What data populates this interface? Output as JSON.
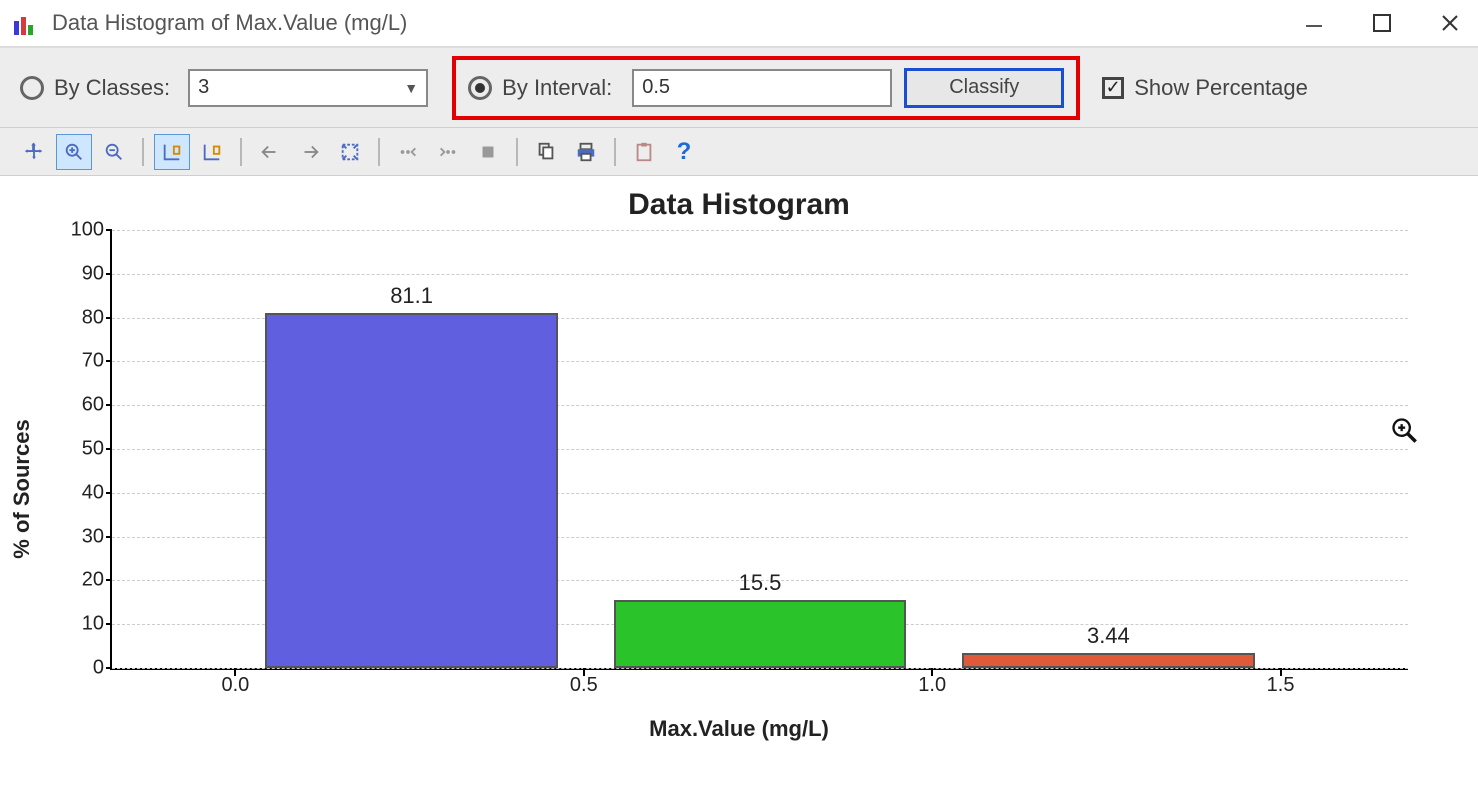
{
  "window": {
    "title": "Data Histogram of Max.Value (mg/L)"
  },
  "controls": {
    "by_classes_label": "By Classes:",
    "classes_value": "3",
    "by_interval_label": "By Interval:",
    "interval_value": "0.5",
    "classify_label": "Classify",
    "show_percentage_label": "Show Percentage",
    "classes_checked": false,
    "interval_checked": true,
    "show_percentage_checked": true
  },
  "toolbar": {
    "icons": [
      "pan",
      "zoom-in",
      "zoom-out",
      "axis-lock-x",
      "axis-lock-y",
      "undo-axis",
      "redo-axis",
      "fit",
      "step-left",
      "step-right",
      "stop",
      "copy",
      "print",
      "paste",
      "help"
    ]
  },
  "chart_data": {
    "type": "bar",
    "title": "Data Histogram",
    "xlabel": "Max.Value (mg/L)",
    "ylabel": "% of Sources",
    "x_ticks": [
      0.0,
      0.5,
      1.0,
      1.5
    ],
    "y_ticks": [
      0,
      10,
      20,
      30,
      40,
      50,
      60,
      70,
      80,
      90,
      100
    ],
    "ylim": [
      0,
      100
    ],
    "bars": [
      {
        "range_start": 0.0,
        "range_end": 0.5,
        "value": 81.1,
        "color": "#605fe0"
      },
      {
        "range_start": 0.5,
        "range_end": 1.0,
        "value": 15.5,
        "color": "#2ac42a"
      },
      {
        "range_start": 1.0,
        "range_end": 1.5,
        "value": 3.44,
        "color": "#e05a3a"
      }
    ],
    "bar_gap_frac": 0.16
  }
}
